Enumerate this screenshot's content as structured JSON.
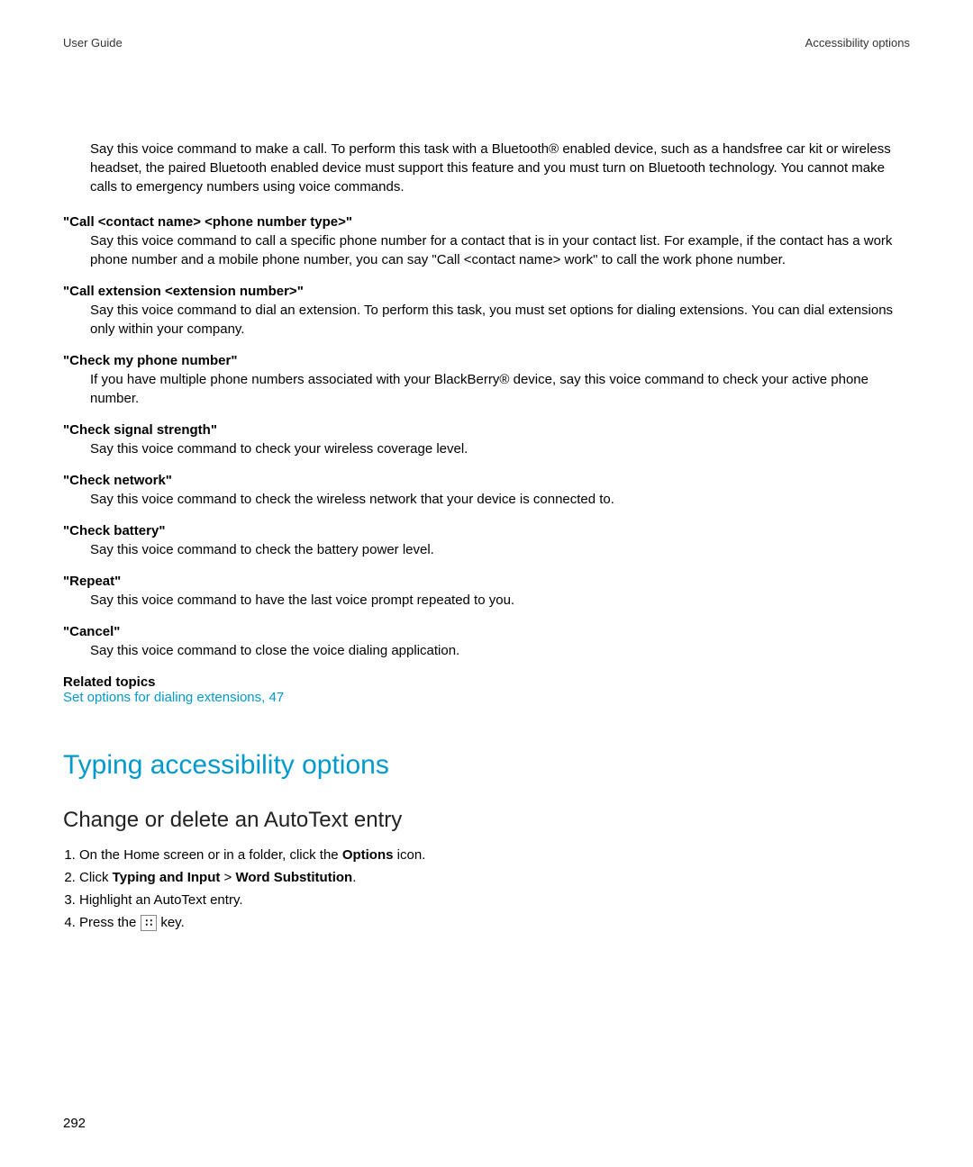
{
  "header": {
    "left": "User Guide",
    "right": "Accessibility options"
  },
  "intro": "Say this voice command to make a call. To perform this task with a Bluetooth® enabled device, such as a handsfree car kit or wireless headset, the paired Bluetooth enabled device must support this feature and you must turn on Bluetooth technology. You cannot make calls to emergency numbers using voice commands.",
  "commands": [
    {
      "title": "\"Call <contact name> <phone number type>\"",
      "desc": "Say this voice command to call a specific phone number for a contact that is in your contact list. For example, if the contact has a work phone number and a mobile phone number, you can say \"Call <contact name> work\" to call the work phone number."
    },
    {
      "title": "\"Call extension <extension number>\"",
      "desc": "Say this voice command to dial an extension. To perform this task, you must set options for dialing extensions. You can dial extensions only within your company."
    },
    {
      "title": "\"Check my phone number\"",
      "desc": "If you have multiple phone numbers associated with your BlackBerry® device, say this voice command to check your active phone number."
    },
    {
      "title": "\"Check signal strength\"",
      "desc": "Say this voice command to check your wireless coverage level."
    },
    {
      "title": "\"Check network\"",
      "desc": "Say this voice command to check the wireless network that your device is connected to."
    },
    {
      "title": "\"Check battery\"",
      "desc": "Say this voice command to check the battery power level."
    },
    {
      "title": "\"Repeat\"",
      "desc": "Say this voice command to have the last voice prompt repeated to you."
    },
    {
      "title": "\"Cancel\"",
      "desc": "Say this voice command to close the voice dialing application."
    }
  ],
  "related": {
    "label": "Related topics",
    "link": "Set options for dialing extensions, 47"
  },
  "section_heading": "Typing accessibility options",
  "sub_heading": "Change or delete an AutoText entry",
  "steps": {
    "s1_pre": "On the Home screen or in a folder, click the ",
    "s1_bold": "Options",
    "s1_post": " icon.",
    "s2_pre": "Click ",
    "s2_b1": "Typing and Input",
    "s2_mid": " > ",
    "s2_b2": "Word Substitution",
    "s2_post": ".",
    "s3": "Highlight an AutoText entry.",
    "s4_pre": "Press the ",
    "s4_icon": "∷",
    "s4_post": " key."
  },
  "page_number": "292"
}
